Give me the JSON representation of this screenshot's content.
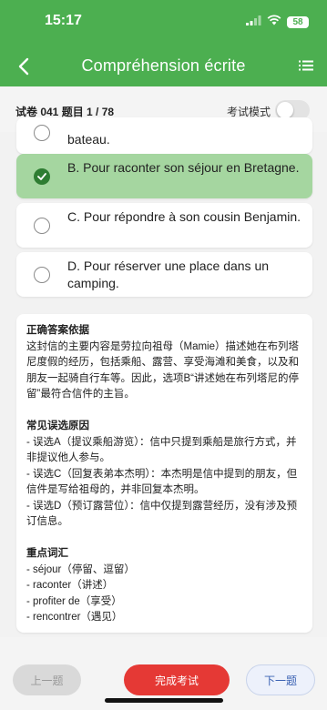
{
  "status_bar": {
    "time": "15:17",
    "battery": "58"
  },
  "header": {
    "title": "Compréhension écrite"
  },
  "subheader": {
    "info": "试卷 041  题目 1 / 78",
    "mode_label": "考试模式",
    "exam_mode_on": false
  },
  "options": [
    {
      "text": "bateau.",
      "selected": false
    },
    {
      "text": "B. Pour raconter son séjour en Bretagne.",
      "selected": true
    },
    {
      "text": "C. Pour répondre à son cousin Benjamin.",
      "selected": false
    },
    {
      "text": "D. Pour réserver une place dans un camping.",
      "selected": false
    }
  ],
  "explanation": {
    "basis_title": "正确答案依据",
    "basis_text": "这封信的主要内容是劳拉向祖母（Mamie）描述她在布列塔尼度假的经历，包括乘船、露营、享受海滩和美食，以及和朋友一起骑自行车等。因此，选项B“讲述她在布列塔尼的停留”最符合信件的主旨。",
    "errors_title": "常见误选原因",
    "errors": [
      "- 误选A（提议乘船游览）：信中只提到乘船是旅行方式，并非提议他人参与。",
      "- 误选C（回复表弟本杰明）：本杰明是信中提到的朋友，但信件是写给祖母的，并非回复本杰明。",
      "- 误选D（预订露营位）：信中仅提到露营经历，没有涉及预订信息。"
    ],
    "vocab_title": "重点词汇",
    "vocab": [
      "- séjour（停留、逗留）",
      "- raconter（讲述）",
      "- profiter de（享受）",
      "- rencontrer（遇见）"
    ]
  },
  "bottom": {
    "prev": "上一题",
    "finish": "完成考试",
    "next": "下一题"
  },
  "colors": {
    "brand": "#4caf50",
    "selected": "#a5d6a0",
    "finish": "#e53935",
    "next_text": "#3b62b3"
  }
}
